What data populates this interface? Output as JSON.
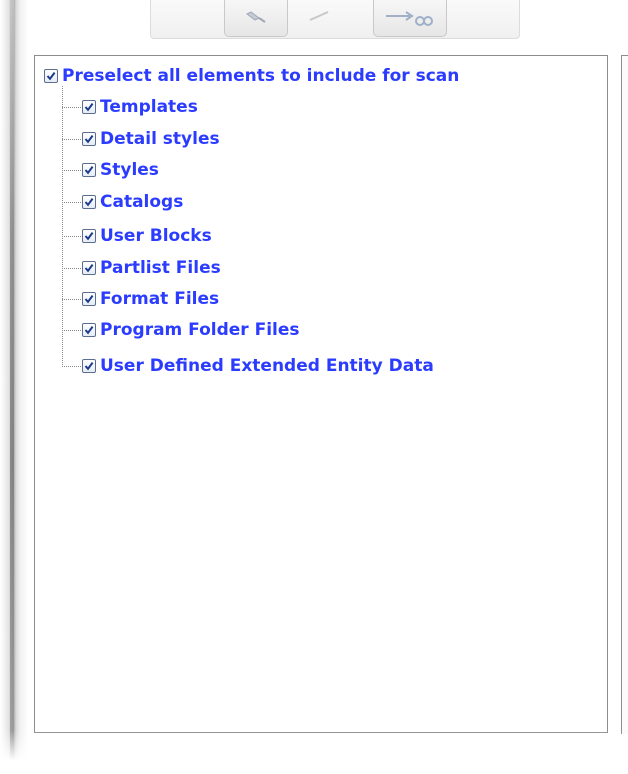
{
  "tree": {
    "root": {
      "label": "Preselect all elements to include for scan",
      "checked": true
    },
    "children": [
      {
        "label": "Templates",
        "checked": true
      },
      {
        "label": "Detail styles",
        "checked": true
      },
      {
        "label": "Styles",
        "checked": true
      },
      {
        "label": "Catalogs",
        "checked": true
      },
      {
        "label": "User Blocks",
        "checked": true
      },
      {
        "label": "Partlist Files",
        "checked": true
      },
      {
        "label": "Format Files",
        "checked": true
      },
      {
        "label": "Program Folder Files",
        "checked": true
      },
      {
        "label": "User Defined Extended Entity Data",
        "checked": true
      }
    ]
  },
  "colors": {
    "label": "#2b3cff",
    "border": "#8c8c8c",
    "checkmark": "#1c3a8c"
  },
  "toolbar": {
    "icons": [
      "pencil-icon",
      "arrow-icon",
      "link-icon"
    ]
  }
}
